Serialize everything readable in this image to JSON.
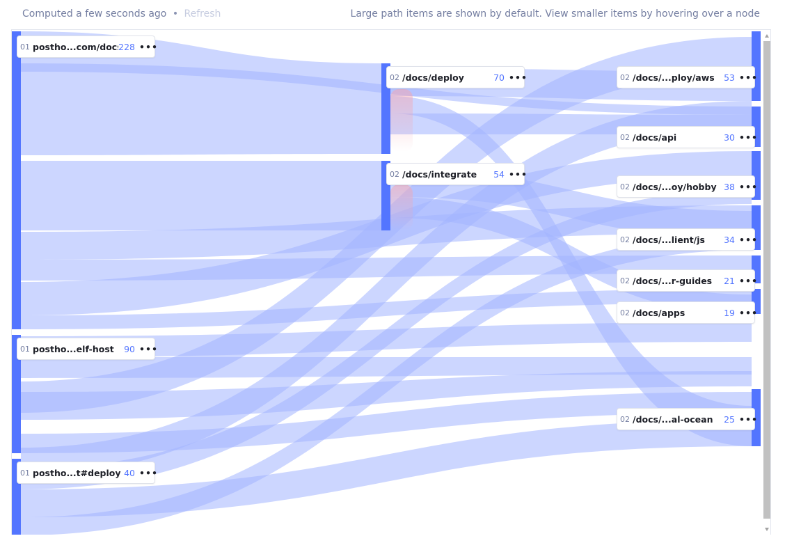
{
  "header": {
    "computed_text": "Computed a few seconds ago",
    "separator": "•",
    "refresh_label": "Refresh",
    "note": "Large path items are shown by default. View smaller items by hovering over a node"
  },
  "colors": {
    "node": "#5375ff",
    "link": "#a3b4ff",
    "accent": "#5375ff",
    "dropoff": "#f5a5b0"
  },
  "nodes": [
    {
      "id": "n1",
      "step": "01",
      "name": "postho...com/docs",
      "count": "228"
    },
    {
      "id": "n2",
      "step": "01",
      "name": "postho...elf-host",
      "count": "90"
    },
    {
      "id": "n3",
      "step": "01",
      "name": "postho...t#deploy",
      "count": "40"
    },
    {
      "id": "m1",
      "step": "02",
      "name": "/docs/deploy",
      "count": "70"
    },
    {
      "id": "m2",
      "step": "02",
      "name": "/docs/integrate",
      "count": "54"
    },
    {
      "id": "r1",
      "step": "02",
      "name": "/docs/...ploy/aws",
      "count": "53"
    },
    {
      "id": "r2",
      "step": "02",
      "name": "/docs/api",
      "count": "30"
    },
    {
      "id": "r3",
      "step": "02",
      "name": "/docs/...oy/hobby",
      "count": "38"
    },
    {
      "id": "r4",
      "step": "02",
      "name": "/docs/...lient/js",
      "count": "34"
    },
    {
      "id": "r5",
      "step": "02",
      "name": "/docs/...r-guides",
      "count": "21"
    },
    {
      "id": "r6",
      "step": "02",
      "name": "/docs/apps",
      "count": "19"
    },
    {
      "id": "r7",
      "step": "02",
      "name": "/docs/...al-ocean",
      "count": "25"
    }
  ],
  "more_icon": "ellipsis-icon"
}
